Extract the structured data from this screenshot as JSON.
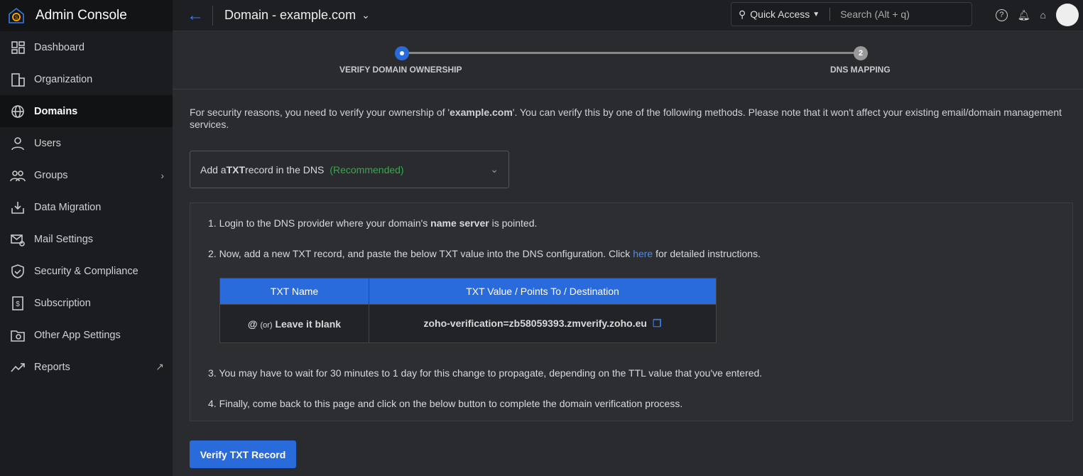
{
  "app": {
    "title": "Admin Console"
  },
  "sidebar": {
    "items": [
      {
        "label": "Dashboard",
        "icon": "dashboard-icon"
      },
      {
        "label": "Organization",
        "icon": "building-icon"
      },
      {
        "label": "Domains",
        "icon": "globe-icon",
        "active": true
      },
      {
        "label": "Users",
        "icon": "user-icon"
      },
      {
        "label": "Groups",
        "icon": "groups-icon",
        "trail": "›"
      },
      {
        "label": "Data Migration",
        "icon": "migration-icon"
      },
      {
        "label": "Mail Settings",
        "icon": "mail-settings-icon"
      },
      {
        "label": "Security & Compliance",
        "icon": "shield-icon"
      },
      {
        "label": "Subscription",
        "icon": "subscription-icon"
      },
      {
        "label": "Other App Settings",
        "icon": "app-settings-icon"
      },
      {
        "label": "Reports",
        "icon": "reports-icon",
        "trail": "↗"
      }
    ]
  },
  "header": {
    "title": "Domain - example.com",
    "quick_access": "Quick Access",
    "search_placeholder": "Search (Alt + q)"
  },
  "stepper": {
    "step1": "VERIFY DOMAIN OWNERSHIP",
    "step2": "DNS MAPPING",
    "step2_num": "2"
  },
  "main": {
    "intro_a": "For security reasons, you need to verify your ownership of '",
    "intro_domain": "example.com",
    "intro_b": "'. You can verify this by one of the following methods. Please note that it won't affect your existing email/domain management services.",
    "method": {
      "a": "Add a ",
      "b": "TXT",
      "c": " record in the DNS",
      "rec": "(Recommended)"
    },
    "step1_a": "1. Login to the DNS provider where your domain's ",
    "step1_b": "name server",
    "step1_c": " is pointed.",
    "step2_a": "2. Now, add a new TXT record, and paste the below TXT value into the DNS configuration. Click ",
    "step2_link": "here",
    "step2_c": " for detailed instructions.",
    "table": {
      "col1": "TXT Name",
      "col2": "TXT Value / Points To / Destination",
      "name_a": "@ ",
      "name_or": "(or)",
      "name_b": " Leave it blank",
      "value": "zoho-verification=zb58059393.zmverify.zoho.eu"
    },
    "step3": "3. You may have to wait for 30 minutes to 1 day for this change to propagate, depending on the TTL value that you've entered.",
    "step4": "4. Finally, come back to this page and click on the below button to complete the domain verification process.",
    "button": "Verify TXT Record"
  }
}
